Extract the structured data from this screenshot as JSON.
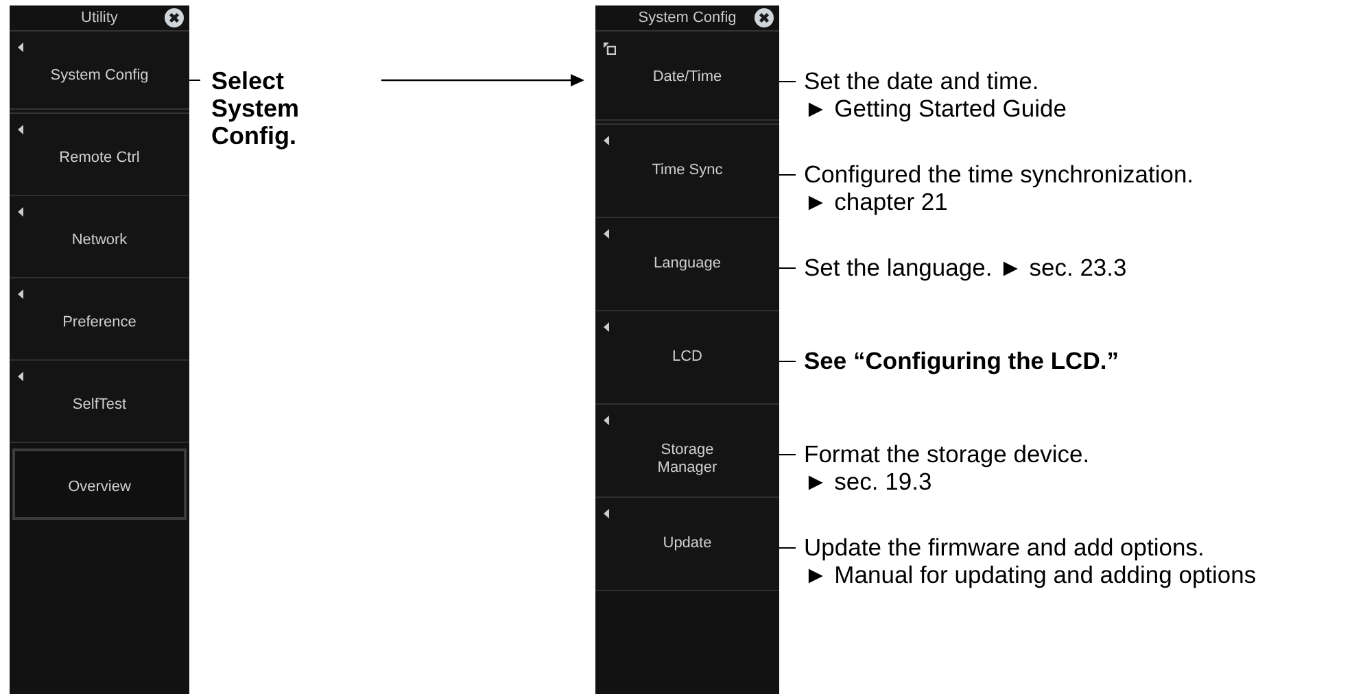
{
  "left_menu": {
    "title": "Utility",
    "items": [
      {
        "label": "System Config",
        "kind": "submenu"
      },
      {
        "label": "Remote Ctrl",
        "kind": "submenu"
      },
      {
        "label": "Network",
        "kind": "submenu"
      },
      {
        "label": "Preference",
        "kind": "submenu"
      },
      {
        "label": "SelfTest",
        "kind": "submenu"
      },
      {
        "label": "Overview",
        "kind": "button"
      }
    ]
  },
  "callout": {
    "text": "Select System Config."
  },
  "right_menu": {
    "title": "System Config",
    "items": [
      {
        "label": "Date/Time",
        "kind": "dialog",
        "note": [
          "Set the date and time.",
          "► Getting Started Guide"
        ],
        "bold": false
      },
      {
        "label": "Time Sync",
        "kind": "submenu",
        "note": [
          "Configured the time synchronization.",
          "► chapter 21"
        ],
        "bold": false
      },
      {
        "label": "Language",
        "kind": "submenu",
        "note": [
          "Set the language. ► sec. 23.3"
        ],
        "bold": false
      },
      {
        "label": "LCD",
        "kind": "submenu",
        "note": [
          "See “Configuring the LCD.”"
        ],
        "bold": true
      },
      {
        "label": "Storage Manager",
        "kind": "submenu",
        "note": [
          "Format the storage device.",
          "► sec. 19.3"
        ],
        "bold": false
      },
      {
        "label": "Update",
        "kind": "submenu",
        "note": [
          "Update the firmware and add options.",
          "► Manual for updating and adding options"
        ],
        "bold": false
      }
    ]
  }
}
